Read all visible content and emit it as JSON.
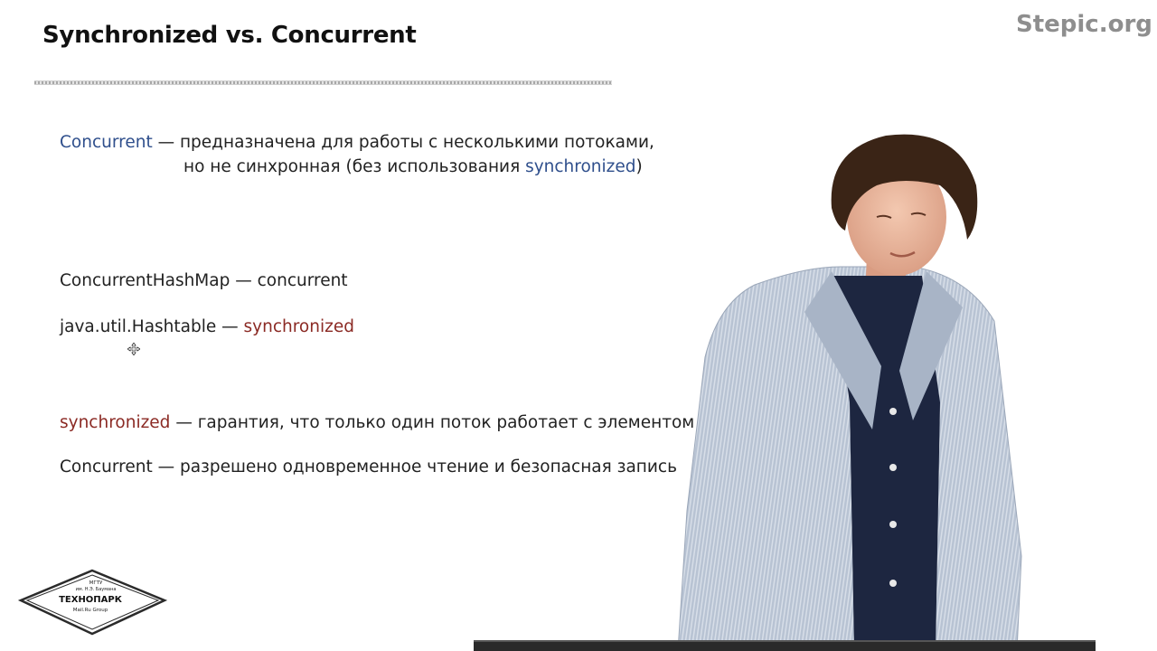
{
  "slide": {
    "title": "Synchronized vs. Concurrent",
    "brand": "Stepic.org"
  },
  "content": {
    "def_term": "Concurrent",
    "def_text_1": " — предназначена для работы с несколькими потоками,",
    "def_text_2a": "но не синхронная (без использования ",
    "def_text_2b": "synchronized",
    "def_text_2c": ")",
    "ex1": "ConcurrentHashMap — concurrent",
    "ex2_a": "java.util.Hashtable — ",
    "ex2_b": "synchronized",
    "cmp1_term": "synchronized",
    "cmp1_text": " — гарантия, что только один поток работает с элементом",
    "cmp2": "Concurrent —  разрешено одновременное чтение и безопасная запись"
  },
  "logo": {
    "line1": "МГТУ",
    "line2": "им. Н.Э. Баумана",
    "line3": "ТЕХНОПАРК",
    "line4": "Mail.Ru Group"
  },
  "colors": {
    "accent_blue": "#2f4f8c",
    "accent_red": "#8b2a24",
    "brand_gray": "#8e8e8e"
  },
  "icons": {
    "cursor": "move-cursor-icon"
  }
}
